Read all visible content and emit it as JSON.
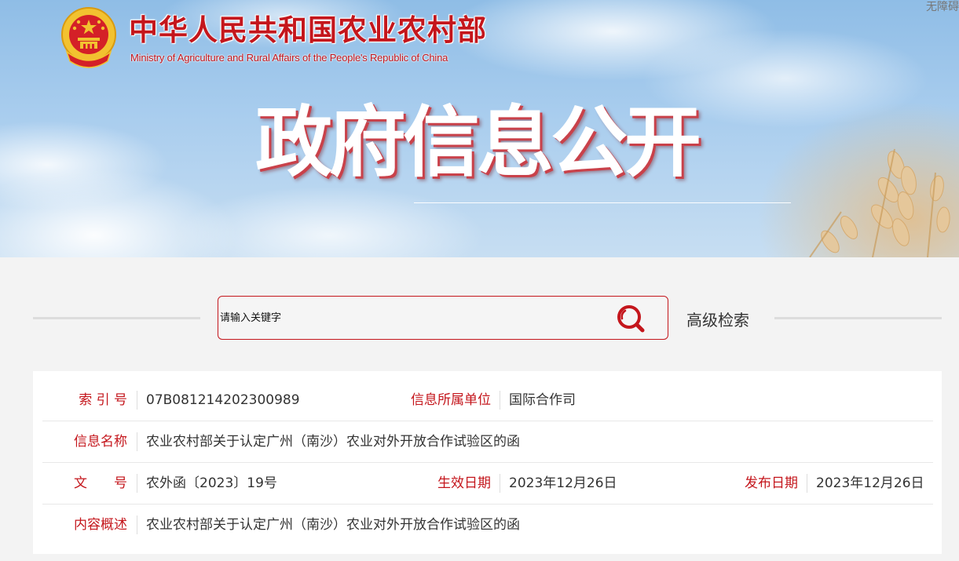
{
  "header": {
    "ministry_cn": "中华人民共和国农业农村部",
    "ministry_en": "Ministry of Agriculture and Rural Affairs of the People's Republic of China",
    "section_title": "政府信息公开",
    "accessibility_link": "无障碍"
  },
  "search": {
    "placeholder": "请输入关键字",
    "button_icon": "search-icon",
    "advanced_label": "高级检索"
  },
  "info": {
    "index_label": "索 引 号",
    "index_value": "07B081214202300989",
    "unit_label": "信息所属单位",
    "unit_value": "国际合作司",
    "name_label": "信息名称",
    "name_value": "农业农村部关于认定广州（南沙）农业对外开放合作试验区的函",
    "docno_label": "文　　号",
    "docno_value": "农外函〔2023〕19号",
    "effective_label": "生效日期",
    "effective_value": "2023年12月26日",
    "publish_label": "发布日期",
    "publish_value": "2023年12月26日",
    "summary_label": "内容概述",
    "summary_value": "农业农村部关于认定广州（南沙）农业对外开放合作试验区的函"
  },
  "colors": {
    "brand_red": "#c4161c",
    "text": "#333333",
    "divider": "#e8e8e8"
  }
}
